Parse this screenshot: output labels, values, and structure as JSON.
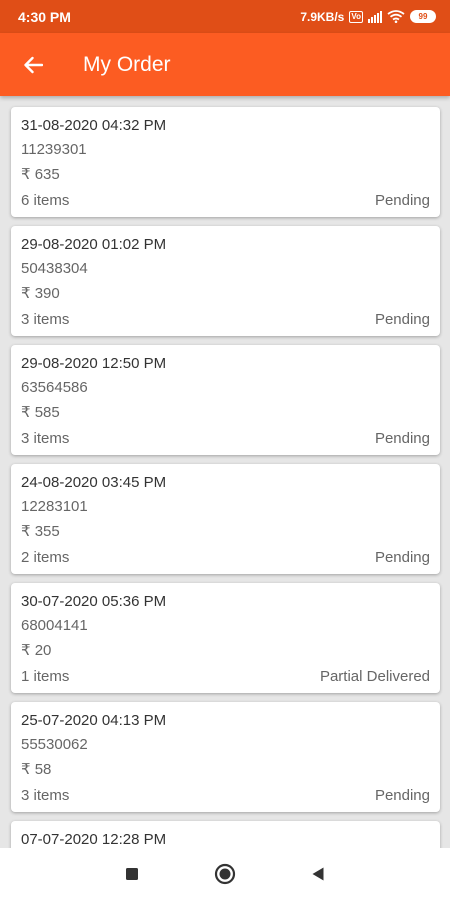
{
  "status_bar": {
    "time": "4:30 PM",
    "network_speed": "7.9KB/s",
    "volte": "Vo",
    "battery": "99"
  },
  "app_bar": {
    "title": "My Order"
  },
  "colors": {
    "status_bar": "#e04e17",
    "app_bar": "#fc5c22"
  },
  "icons": {
    "back": "arrow-left-icon",
    "wifi": "wifi-icon",
    "signal": "signal-icon",
    "battery": "battery-icon",
    "nav_recents": "square-icon",
    "nav_home": "circle-icon",
    "nav_back": "triangle-back-icon"
  },
  "orders": [
    {
      "date": "31-08-2020 04:32 PM",
      "order_no": "11239301",
      "amount": "₹ 635",
      "items": "6 items",
      "status": "Pending"
    },
    {
      "date": "29-08-2020 01:02 PM",
      "order_no": "50438304",
      "amount": "₹ 390",
      "items": "3 items",
      "status": "Pending"
    },
    {
      "date": "29-08-2020 12:50 PM",
      "order_no": "63564586",
      "amount": "₹ 585",
      "items": "3 items",
      "status": "Pending"
    },
    {
      "date": "24-08-2020 03:45 PM",
      "order_no": "12283101",
      "amount": "₹ 355",
      "items": "2 items",
      "status": "Pending"
    },
    {
      "date": "30-07-2020 05:36 PM",
      "order_no": "68004141",
      "amount": "₹ 20",
      "items": "1 items",
      "status": "Partial Delivered"
    },
    {
      "date": "25-07-2020 04:13 PM",
      "order_no": "55530062",
      "amount": "₹ 58",
      "items": "3 items",
      "status": "Pending"
    },
    {
      "date": "07-07-2020 12:28 PM",
      "order_no": "",
      "amount": "",
      "items": "",
      "status": ""
    }
  ]
}
